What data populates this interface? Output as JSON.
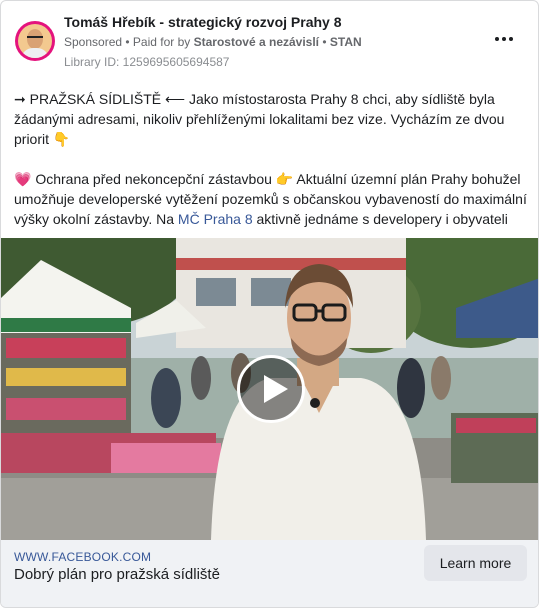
{
  "header": {
    "page_name": "Tomáš Hřebík - strategický rozvoj Prahy 8",
    "sponsored": "Sponsored",
    "dot": " • ",
    "paid_for_prefix": "Paid for by ",
    "payer": "Starostové a nezávislí",
    "dot2": " • ",
    "party": "STAN",
    "library_id": "Library ID: 1259695605694587",
    "more_icon": "three-dots-icon"
  },
  "post": {
    "line1": "➞ PRAŽSKÁ SÍDLIŠTĚ ⟵ Jako místostarosta Prahy 8 chci, aby sídliště byla žádanými adresami, nikoliv přehlíženými lokalitami bez vize. Vycházím ze dvou priorit 👇",
    "line2_before": "💗  Ochrana před nekoncepční zástavbou 👉  Aktuální územní plán Prahy bohužel umožňuje developerské vytěžení pozemků s občanskou vybaveností do maximální výšky okolní zástavby. Na ",
    "line2_link": "MČ Praha 8",
    "line2_after": " aktivně jednáme s developery i obyvateli a…"
  },
  "video": {
    "play_icon": "play-icon"
  },
  "footer": {
    "domain": "WWW.FACEBOOK.COM",
    "headline": "Dobrý plán pro pražská sídliště",
    "cta_label": "Learn more"
  },
  "colors": {
    "link": "#385898",
    "avatar_ring": "#e4137d",
    "footer_bg": "#f0f2f5"
  }
}
